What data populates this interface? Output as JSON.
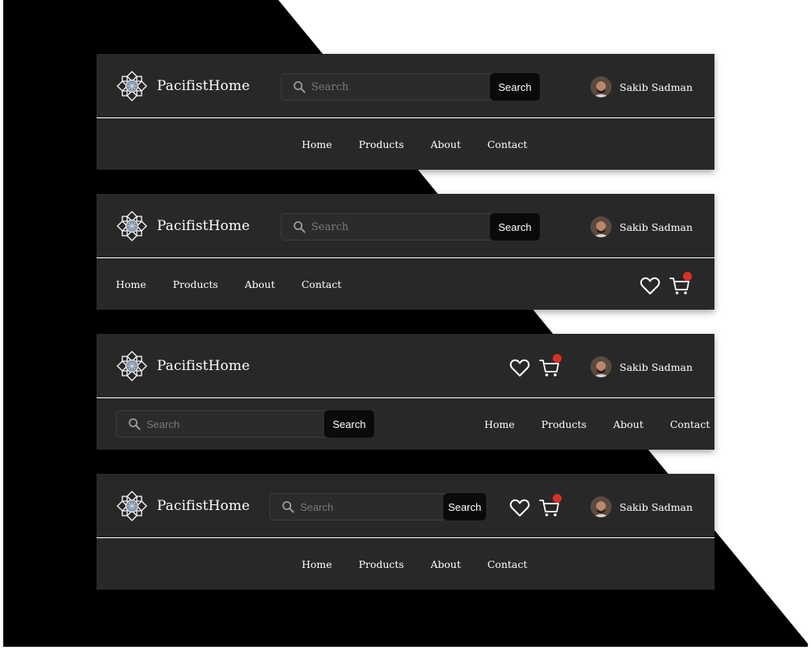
{
  "brand": {
    "name": "PacifistHome"
  },
  "search": {
    "placeholder": "Search",
    "button_label": "Search"
  },
  "user": {
    "name": "Sakib Sadman"
  },
  "nav": {
    "items": [
      "Home",
      "Products",
      "About",
      "Contact"
    ]
  },
  "colors": {
    "bar": "#282828",
    "badge": "#d93025",
    "search_button": "#0a0a0a",
    "page_dark": "#000000"
  },
  "icons": {
    "logo": "lotus-logo-icon",
    "search": "search-icon",
    "wishlist": "heart-icon",
    "cart": "cart-icon"
  },
  "cart": {
    "has_notification": true
  }
}
